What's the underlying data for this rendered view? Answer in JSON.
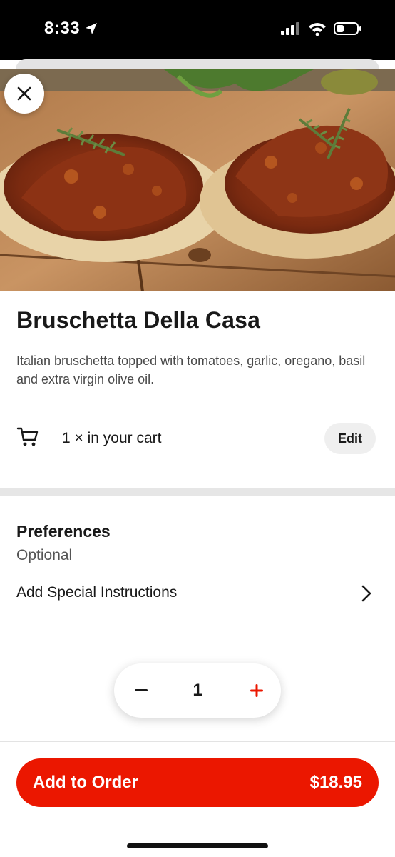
{
  "status_bar": {
    "time": "8:33",
    "battery_level": 0.3
  },
  "hero": {
    "image_alt": "Bruschetta with meat sauce and rosemary on wooden board"
  },
  "item": {
    "title": "Bruschetta Della Casa",
    "description": "Italian bruschetta topped with tomatoes, garlic, oregano, basil and extra virgin olive oil."
  },
  "cart": {
    "text": "1 × in your cart",
    "edit_label": "Edit",
    "icon": "cart-icon"
  },
  "preferences": {
    "title": "Preferences",
    "subtitle": "Optional",
    "special_instructions_label": "Add Special Instructions"
  },
  "stepper": {
    "minus": "−",
    "value": "1",
    "plus": "+"
  },
  "footer": {
    "add_label": "Add to Order",
    "price": "$18.95"
  },
  "colors": {
    "accent": "#eb1700",
    "text": "#191919",
    "muted": "#494949"
  }
}
